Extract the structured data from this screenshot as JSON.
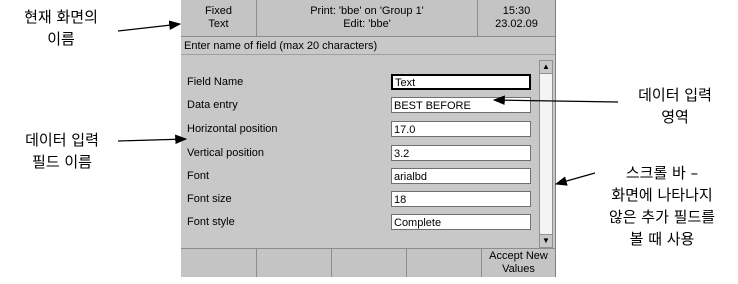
{
  "header": {
    "mode_line1": "Fixed",
    "mode_line2": "Text",
    "print_line1": "Print: 'bbe' on 'Group 1'",
    "print_line2": "Edit: 'bbe'",
    "time": "15:30",
    "date": "23.02.09"
  },
  "message": "Enter name of field (max 20 characters)",
  "fields": [
    {
      "label": "Field Name",
      "value": "Text"
    },
    {
      "label": "Data entry",
      "value": "BEST BEFORE"
    },
    {
      "label": "Horizontal position",
      "value": "17.0"
    },
    {
      "label": "Vertical position",
      "value": "3.2"
    },
    {
      "label": "Font",
      "value": "arialbd"
    },
    {
      "label": "Font size",
      "value": "18"
    },
    {
      "label": "Font style",
      "value": "Complete"
    }
  ],
  "softkeys": {
    "key5_line1": "Accept New",
    "key5_line2": "Values"
  },
  "annotations": {
    "screen_name_1": "현재 화면의",
    "screen_name_2": "이름",
    "field_names_1": "데이터 입력",
    "field_names_2": "필드 이름",
    "data_area_1": "데이터 입력",
    "data_area_2": "영역",
    "scroll_1": "스크롤 바 –",
    "scroll_2": "화면에 나타나지",
    "scroll_3": "않은 추가 필드를",
    "scroll_4": "볼 때 사용"
  },
  "icons": {
    "scroll_up": "triangle-up",
    "scroll_down": "triangle-down"
  }
}
